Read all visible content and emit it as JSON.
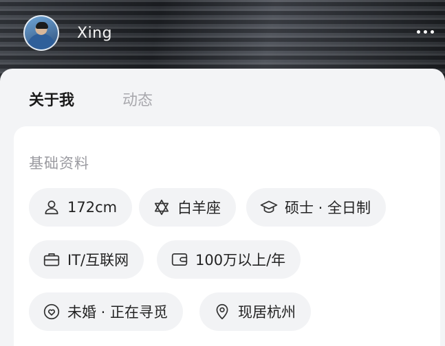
{
  "header": {
    "username": "Xing",
    "avatar_icon": "user-avatar"
  },
  "tabs": [
    {
      "label": "关于我",
      "active": true
    },
    {
      "label": "动态",
      "active": false
    }
  ],
  "basic_info": {
    "title": "基础资料",
    "tags": [
      {
        "icon": "person-icon",
        "label": "172cm"
      },
      {
        "icon": "star-of-david-icon",
        "label": "白羊座"
      },
      {
        "icon": "graduation-cap-icon",
        "label": "硕士 · 全日制"
      },
      {
        "icon": "briefcase-icon",
        "label": "IT/互联网"
      },
      {
        "icon": "wallet-icon",
        "label": "100万以上/年"
      },
      {
        "icon": "heart-icon",
        "label": "未婚 · 正在寻觅"
      },
      {
        "icon": "location-pin-icon",
        "label": "现居杭州"
      }
    ]
  },
  "colors": {
    "sheet_bg": "#f3f4f6",
    "card_bg": "#ffffff",
    "tag_bg": "#f2f3f5",
    "muted_text": "#a8a8ad"
  }
}
